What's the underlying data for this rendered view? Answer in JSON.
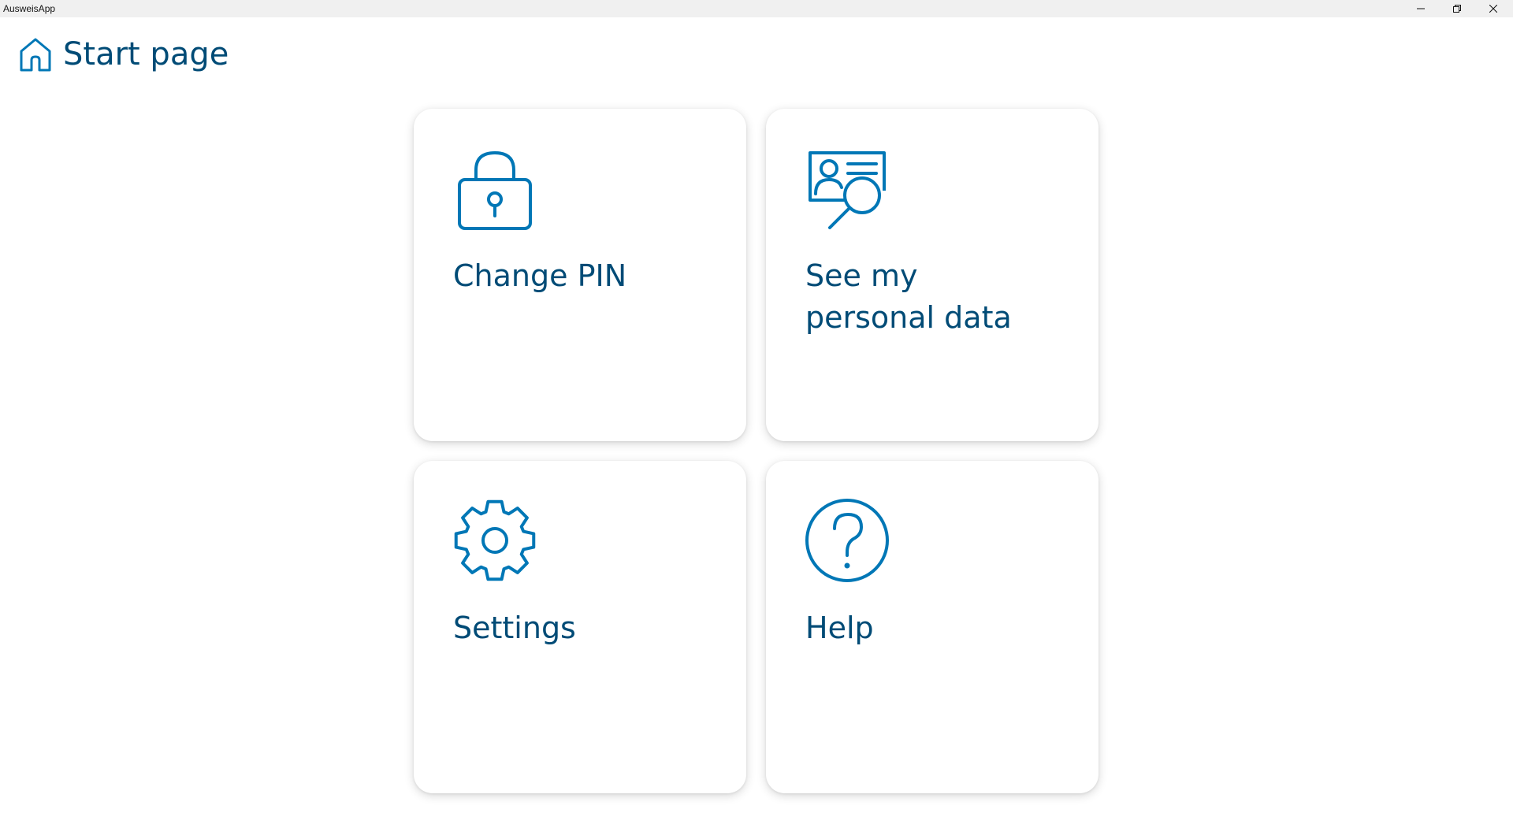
{
  "window": {
    "title": "AusweisApp",
    "controls": {
      "minimize": "minimize-icon",
      "maximize": "restore-icon",
      "close": "close-icon"
    }
  },
  "header": {
    "icon": "home-icon",
    "title": "Start page"
  },
  "tiles": [
    {
      "icon": "lock-icon",
      "label": "Change PIN"
    },
    {
      "icon": "id-card-search-icon",
      "label": "See my\npersonal data"
    },
    {
      "icon": "gear-icon",
      "label": "Settings"
    },
    {
      "icon": "help-icon",
      "label": "Help"
    }
  ],
  "colors": {
    "accent": "#0077b6",
    "text": "#004b76",
    "titlebar": "#f0f0f0"
  }
}
